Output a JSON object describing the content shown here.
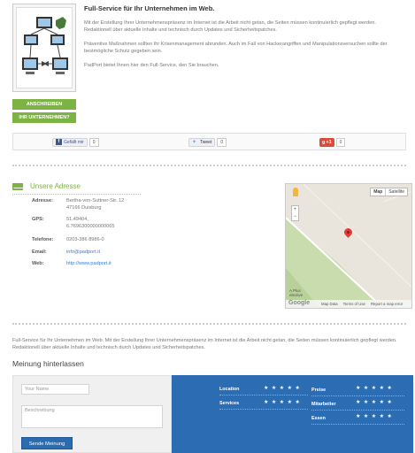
{
  "top": {
    "title": "Full-Service für Ihr Unternehmen im Web.",
    "paragraphs": [
      "Mit der Erstellung Ihrer Unternehmenspräsenz im Internet ist die Arbeit nicht getan, die Seiten müssen kontinuierlich gepflegt werden. Redaktionell über aktuelle Inhalte und technisch durch Updates und Sicherheitspatches.",
      "Präventive Maßnahmen sollten Ihr Krisenmanagement abrunden. Auch im Fall von Hackerangriffen und Manipulationsversuchen sollte der bestmögliche Schutz gegeben sein.",
      "PadPort bietet Ihnen hier den Full-Service, den Sie brauchen."
    ],
    "btn_anschreiben": "ANSCHREIBEN",
    "btn_ihr_unternehmen": "IHR UNTERNEHMEN?"
  },
  "social": {
    "fb_label": "Gefällt mir",
    "fb_count": "0",
    "tw_label": "Tweet",
    "tw_count": "0",
    "g_label": "+1",
    "g_count": "0"
  },
  "address": {
    "heading": "Unsere Adresse",
    "rows": [
      {
        "label": "Adresse:",
        "value": "Bertha-von-Suttner-Str. 12\n47166 Duisburg"
      },
      {
        "label": "GPS:",
        "value": "51.49404,\n6.7696300000000065"
      },
      {
        "label": "Telefone:",
        "value": "0203-386 8986-0"
      },
      {
        "label": "Email:",
        "value": "info@padport.it"
      },
      {
        "label": "Web:",
        "value": "http://www.padport.it"
      }
    ]
  },
  "map": {
    "type_map": "Map",
    "type_satellite": "Satellite",
    "zoom_in": "+",
    "zoom_out": "−",
    "logo": "Google",
    "label": "A Plus\nelective",
    "footer": [
      "Map Data",
      "Terms of Use",
      "Report a map error"
    ]
  },
  "description": "Full-Service für Ihr Unternehmen im Web. Mit der Erstellung Ihrer Unternehmenspräsenz im Internet ist die Arbeit nicht getan, die Seiten müssen kontinuierlich gepflegt werden. Redaktionell über aktuelle Inhalte und technisch durch Updates und Sicherheitspatches.",
  "review": {
    "title": "Meinung hinterlassen",
    "name_placeholder": "Your Name",
    "desc_placeholder": "Beschreibung",
    "send_label": "Sende Meinung",
    "ratings": [
      {
        "label": "Location",
        "stars": "★★★★★"
      },
      {
        "label": "Preise",
        "stars": "★★★★★"
      },
      {
        "label": "Services",
        "stars": "★★★★★"
      },
      {
        "label": "Mitarbeiter",
        "stars": "★★★★★"
      },
      {
        "label": "Essen",
        "stars": "★★★★★"
      }
    ]
  },
  "colors": {
    "accent_green": "#7cb342",
    "rating_blue": "#2c6cb3",
    "link_blue": "#3a7bd5"
  }
}
